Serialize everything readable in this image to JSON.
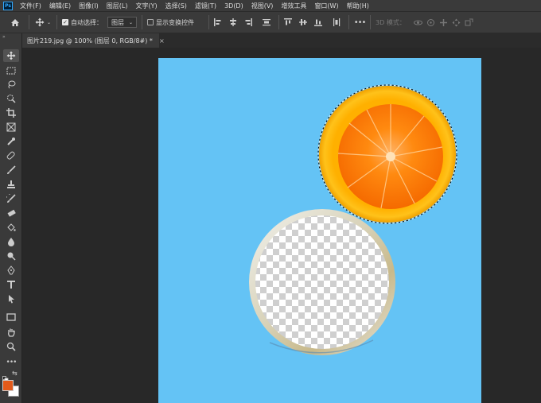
{
  "app": {
    "logo": "Ps"
  },
  "menu": [
    "文件(F)",
    "编辑(E)",
    "图像(I)",
    "图层(L)",
    "文字(Y)",
    "选择(S)",
    "滤镜(T)",
    "3D(D)",
    "视图(V)",
    "增效工具",
    "窗口(W)",
    "帮助(H)"
  ],
  "options": {
    "auto_select_label": "自动选择：",
    "layer_select_value": "图层",
    "show_transform_label": "显示变换控件",
    "mode_3d_label": "3D 模式："
  },
  "document_tab": {
    "title": "图片219.jpg @ 100% (图层 0, RGB/8#) *",
    "close": "×"
  },
  "colors": {
    "foreground": "#e35a1a",
    "background": "#ffffff",
    "canvas": "#64c3f5"
  },
  "tools": [
    "move-icon",
    "marquee-icon",
    "lasso-icon",
    "quick-select-icon",
    "crop-icon",
    "frame-icon",
    "eyedropper-icon",
    "healing-brush-icon",
    "brush-icon",
    "clone-stamp-icon",
    "history-brush-icon",
    "eraser-icon",
    "paint-bucket-icon",
    "blur-icon",
    "dodge-icon",
    "pen-icon",
    "type-icon",
    "path-select-icon",
    "rectangle-icon",
    "hand-icon",
    "zoom-icon",
    "more-tools-icon"
  ]
}
